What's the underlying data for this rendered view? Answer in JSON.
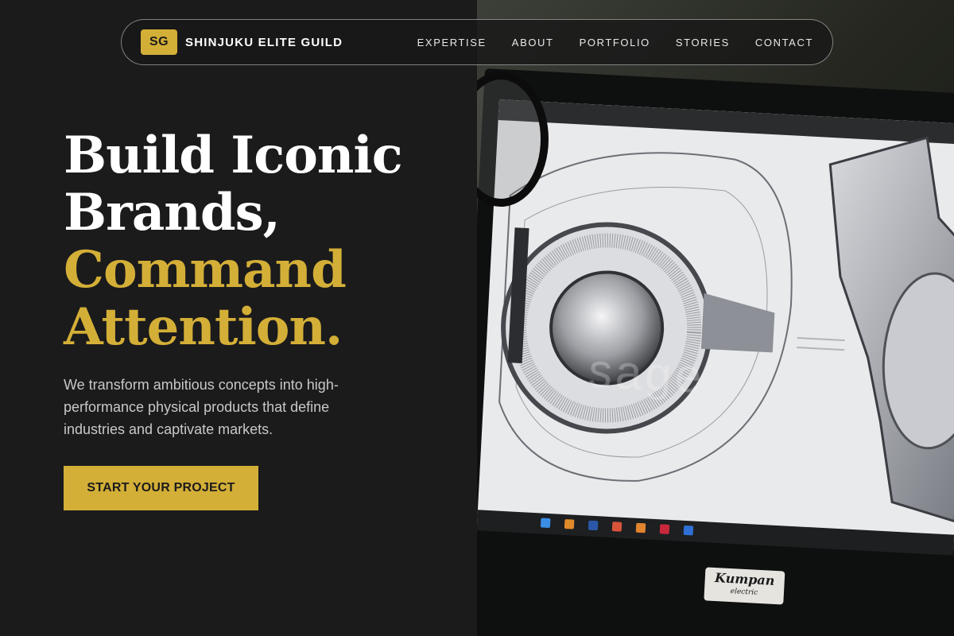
{
  "nav": {
    "logo_badge": "SG",
    "brand_name": "SHINJUKU ELITE GUILD",
    "links": [
      {
        "label": "EXPERTISE"
      },
      {
        "label": "ABOUT"
      },
      {
        "label": "PORTFOLIO"
      },
      {
        "label": "STORIES"
      },
      {
        "label": "CONTACT"
      }
    ]
  },
  "hero": {
    "headline_line1": "Build Iconic",
    "headline_line2": "Brands,",
    "headline_line3": "Command",
    "headline_line4": "Attention.",
    "subtitle": "We transform ambitious concepts into high-performance physical products that define industries and captivate markets.",
    "cta_label": "START YOUR PROJECT"
  },
  "illustration": {
    "monitor_brand": "Kumpan",
    "monitor_brand_sub": "electric",
    "screen_watermark": "sage"
  },
  "colors": {
    "accent": "#d4af37",
    "background": "#1b1b1c"
  }
}
